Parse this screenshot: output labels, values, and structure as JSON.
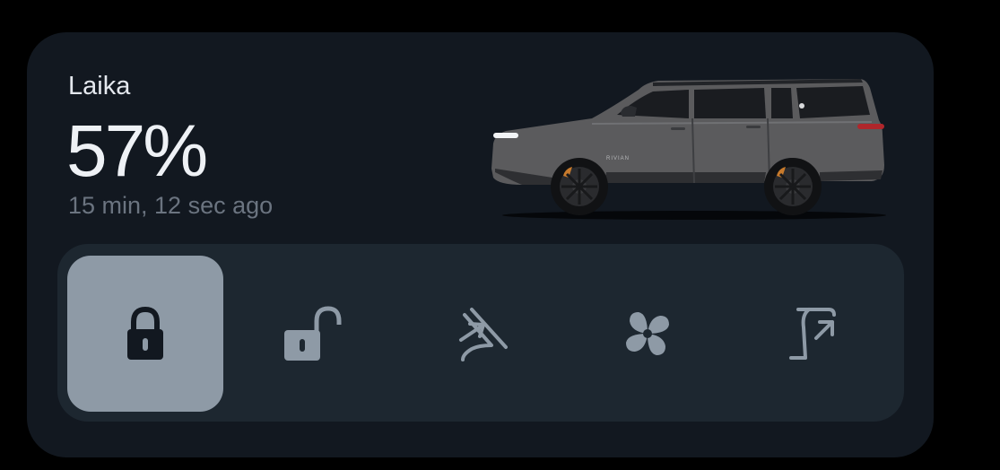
{
  "vehicle": {
    "name": "Laika",
    "battery": "57%",
    "last_updated": "15 min, 12 sec ago",
    "badge_text": "RIVIAN"
  },
  "controls": [
    {
      "icon": "lock-icon",
      "action": "lock",
      "active": true
    },
    {
      "icon": "unlock-icon",
      "action": "unlock",
      "active": false
    },
    {
      "icon": "frunk-icon",
      "action": "open-frunk",
      "active": false
    },
    {
      "icon": "fan-icon",
      "action": "climate",
      "active": false
    },
    {
      "icon": "liftgate-icon",
      "action": "open-liftgate",
      "active": false
    }
  ],
  "colors": {
    "background": "#000000",
    "card": "#121820",
    "controls_panel": "#1d2730",
    "active_button": "#8e9aa6",
    "icon_active": "#121820",
    "icon_inactive": "#8e9aa6",
    "car_body": "#5b5b5d",
    "brake_caliper": "#c77a2c"
  }
}
